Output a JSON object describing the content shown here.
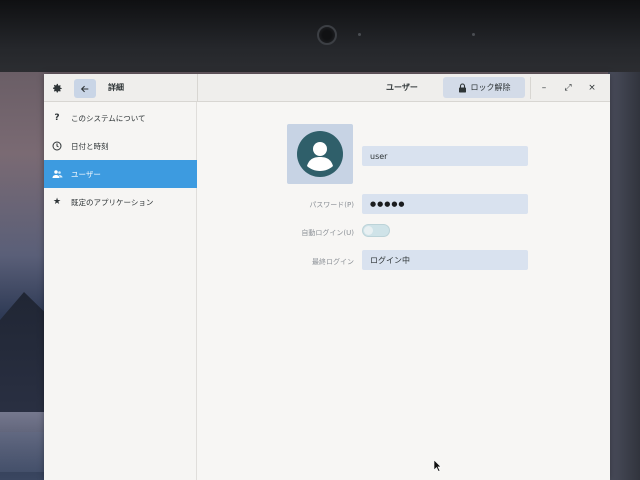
{
  "titlebar": {
    "left_title": "詳細",
    "title": "ユーザー",
    "unlock_label": "ロック解除",
    "minimize_label": "–",
    "maximize_label": "⤢",
    "close_label": "×"
  },
  "sidebar": {
    "items": [
      {
        "label": "このシステムについて",
        "icon": "question-icon",
        "glyph": "?"
      },
      {
        "label": "日付と時刻",
        "icon": "clock-icon",
        "glyph": ""
      },
      {
        "label": "ユーザー",
        "icon": "users-icon",
        "glyph": "",
        "selected": true
      },
      {
        "label": "既定のアプリケーション",
        "icon": "star-icon",
        "glyph": "★"
      }
    ]
  },
  "user": {
    "username": "user",
    "password_label": "パスワード(P)",
    "password_value": "●●●●●",
    "autologin_label": "自動ログイン(U)",
    "autologin_on": false,
    "lastlogin_label": "最終ログイン",
    "lastlogin_value": "ログイン中"
  },
  "colors": {
    "accent": "#3d9be0",
    "field_bg": "#d9e2ef",
    "avatar": "#2f5f6a"
  }
}
